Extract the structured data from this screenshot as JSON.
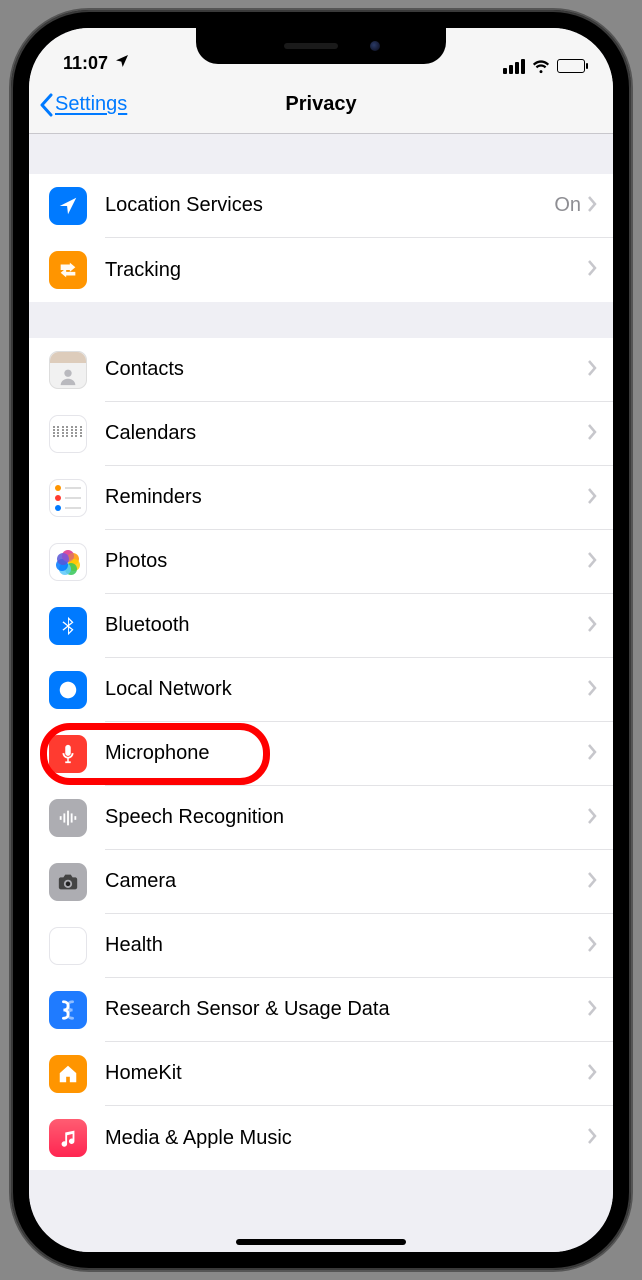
{
  "status": {
    "time": "11:07",
    "location_arrow": "location-arrow-icon"
  },
  "nav": {
    "back_label": "Settings",
    "title": "Privacy"
  },
  "groups": [
    {
      "rows": [
        {
          "id": "location-services",
          "label": "Location Services",
          "detail": "On",
          "icon": "location-arrow-icon",
          "c": "c-blue"
        },
        {
          "id": "tracking",
          "label": "Tracking",
          "icon": "tracking-icon",
          "c": "c-orange"
        }
      ]
    },
    {
      "rows": [
        {
          "id": "contacts",
          "label": "Contacts",
          "icon": "contacts-icon",
          "c": "contacts-icon"
        },
        {
          "id": "calendars",
          "label": "Calendars",
          "icon": "calendar-icon",
          "c": "c-white"
        },
        {
          "id": "reminders",
          "label": "Reminders",
          "icon": "reminders-icon",
          "c": "c-white"
        },
        {
          "id": "photos",
          "label": "Photos",
          "icon": "photos-icon",
          "c": "c-white"
        },
        {
          "id": "bluetooth",
          "label": "Bluetooth",
          "icon": "bluetooth-icon",
          "c": "c-bluetooth"
        },
        {
          "id": "local-network",
          "label": "Local Network",
          "icon": "globe-icon",
          "c": "c-blue"
        },
        {
          "id": "microphone",
          "label": "Microphone",
          "icon": "microphone-icon",
          "c": "c-red",
          "highlight": true
        },
        {
          "id": "speech-recognition",
          "label": "Speech Recognition",
          "icon": "waveform-icon",
          "c": "c-gray"
        },
        {
          "id": "camera",
          "label": "Camera",
          "icon": "camera-icon",
          "c": "c-gray"
        },
        {
          "id": "health",
          "label": "Health",
          "icon": "heart-icon",
          "c": "c-white"
        },
        {
          "id": "research",
          "label": "Research Sensor & Usage Data",
          "icon": "research-icon",
          "c": "s-icon"
        },
        {
          "id": "homekit",
          "label": "HomeKit",
          "icon": "home-icon",
          "c": "c-orange-home"
        },
        {
          "id": "media",
          "label": "Media & Apple Music",
          "icon": "music-icon",
          "c": "c-music"
        }
      ]
    }
  ]
}
